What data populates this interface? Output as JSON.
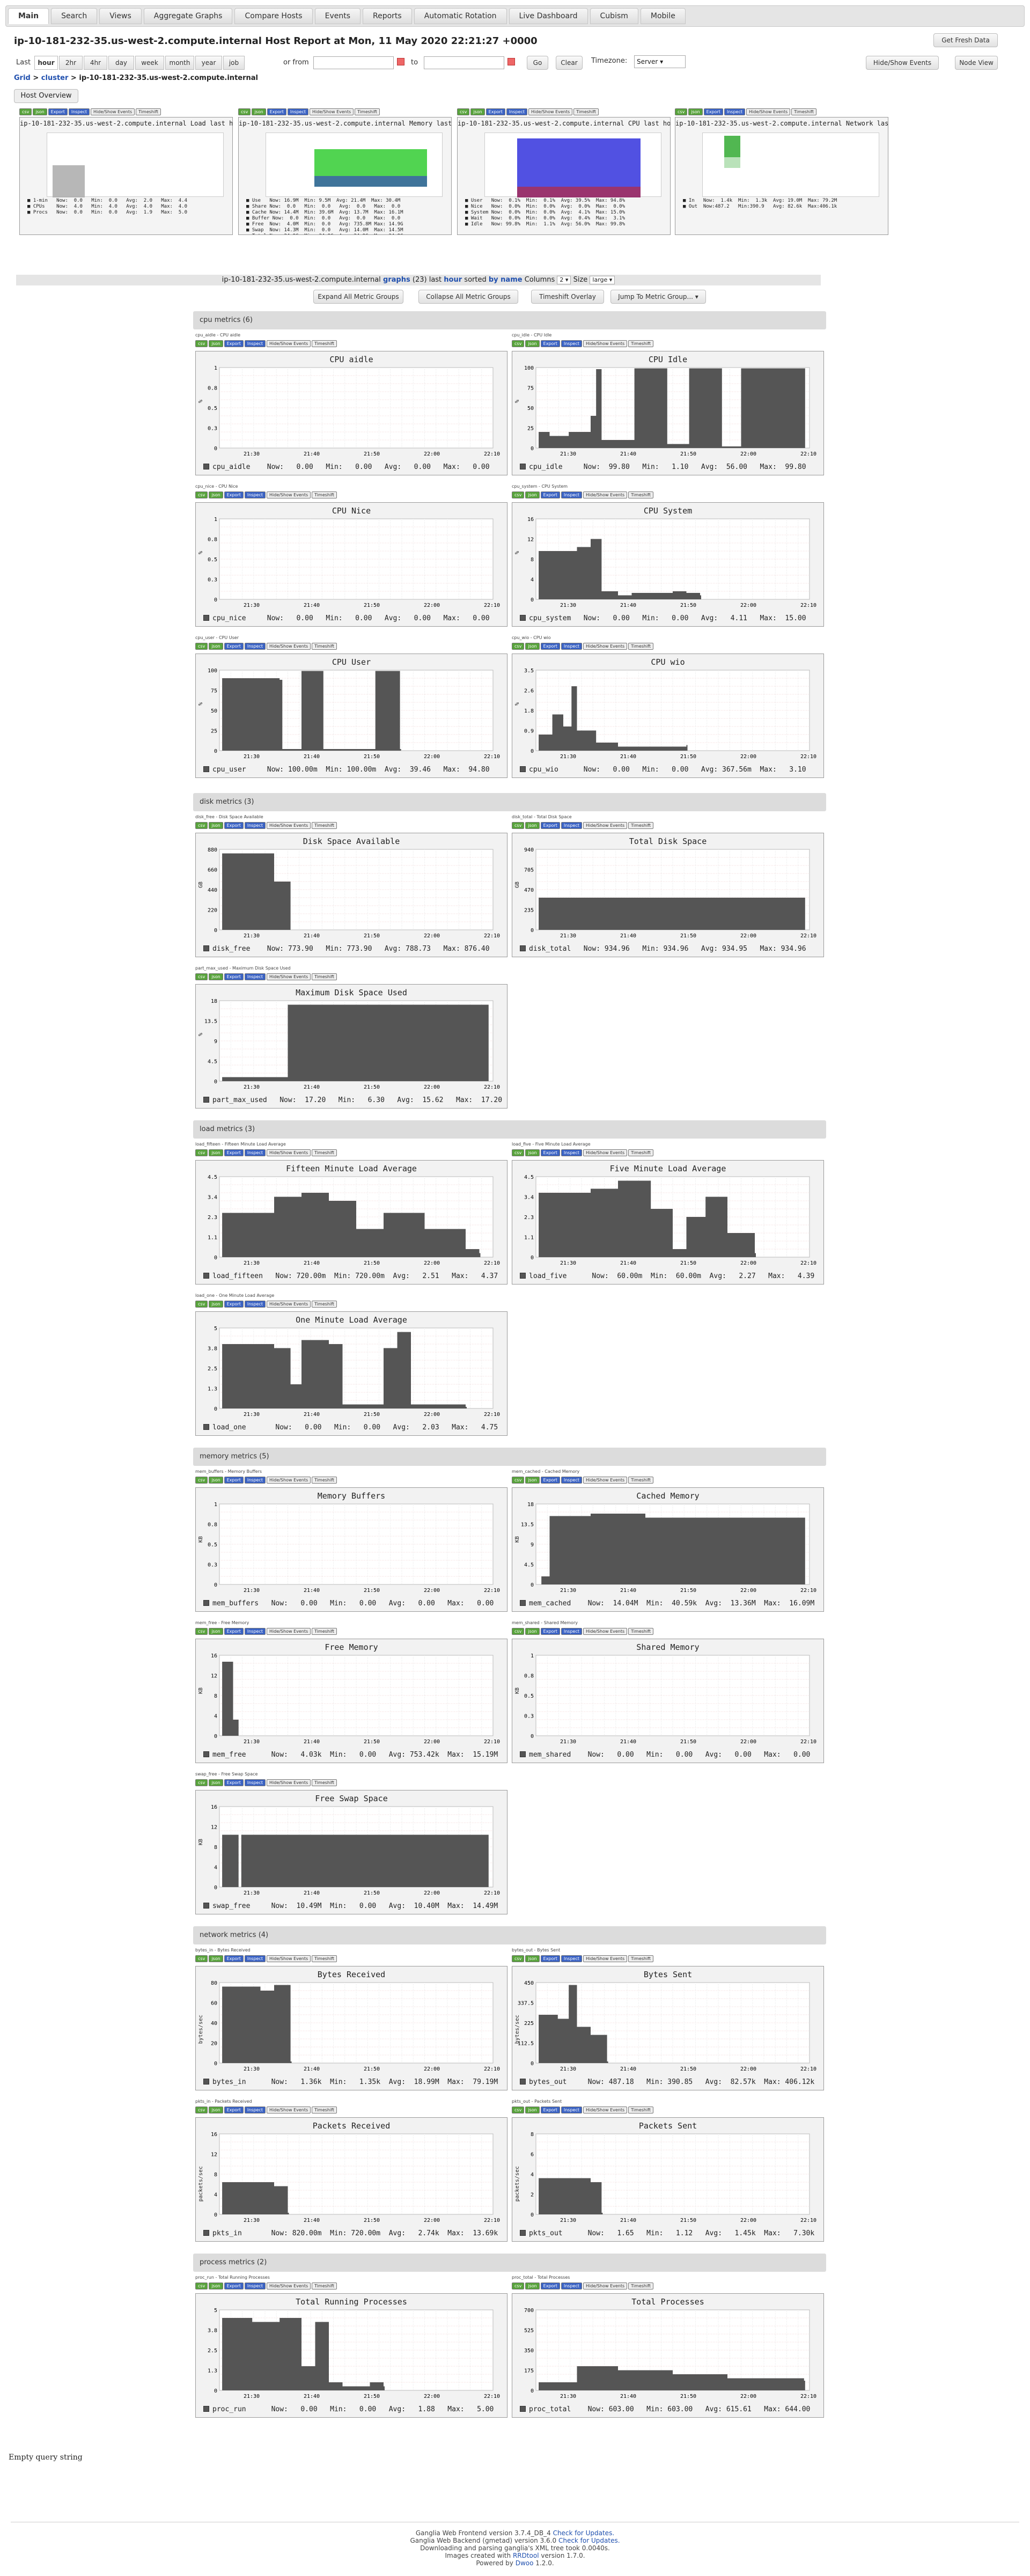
{
  "tabs": [
    "Main",
    "Search",
    "Views",
    "Aggregate Graphs",
    "Compare Hosts",
    "Events",
    "Reports",
    "Automatic Rotation",
    "Live Dashboard",
    "Cubism",
    "Mobile"
  ],
  "header": {
    "title": "ip-10-181-232-35.us-west-2.compute.internal Host Report at Mon, 11 May 2020 22:21:27 +0000",
    "fresh_button": "Get Fresh Data"
  },
  "toolbar": {
    "last_label": "Last",
    "ranges": [
      "hour",
      "2hr",
      "4hr",
      "day",
      "week",
      "month",
      "year",
      "job"
    ],
    "active_range": "hour",
    "or_from": "or from",
    "to": "to",
    "go": "Go",
    "clear": "Clear",
    "timezone_label": "Timezone:",
    "timezone_value": "Server",
    "hide_show": "Hide/Show Events",
    "node_view": "Node View"
  },
  "breadcrumb": {
    "grid": "Grid",
    "sep": " > ",
    "cluster": "cluster",
    "host": "ip-10-181-232-35.us-west-2.compute.internal"
  },
  "overview": {
    "label": "Host Overview",
    "graphs": [
      {
        "title": "ip-10-181-232-35.us-west-2.compute.internal Load last hour",
        "legend": "■ 1-min   Now:  0.0   Min:  0.0   Avg:  2.0   Max:  4.4\n■ CPUs    Now:  4.0   Min:  4.0   Avg:  4.0   Max:  4.0\n■ Procs   Now:  0.0   Min:  0.0   Avg:  1.9   Max:  5.0"
      },
      {
        "title": "ip-10-181-232-35.us-west-2.compute.internal Memory last hour",
        "legend": "■ Use   Now: 16.9M  Min: 9.5M  Avg: 21.4M  Max: 30.4M\n■ Share Now:  0.0   Min:  0.0   Avg:  0.0   Max:  0.0\n■ Cache Now: 14.4M  Min: 39.6M  Avg: 13.7M  Max: 16.1M\n■ Buffer Now:  0.0  Min:  0.0   Avg:  0.0   Max:  0.0\n■ Free  Now:  4.0M  Min:  0.0   Avg: 735.8M Max: 14.9G\n■ Swap  Now: 14.3M  Min:  0.0   Avg: 14.0M  Max: 14.5M\n■ Total Now: 24.9G  Min: 24.9G  Avg: 24.9G  Max: 24.9G"
      },
      {
        "title": "ip-10-181-232-35.us-west-2.compute.internal CPU last hour",
        "legend": "■ User   Now:  0.1%  Min:  0.1%  Avg: 39.5%  Max: 94.8%\n■ Nice   Now:  0.0%  Min:  0.0%  Avg:  0.0%  Max:  0.0%\n■ System Now:  0.0%  Min:  0.0%  Avg:  4.1%  Max: 15.0%\n■ Wait   Now:  0.0%  Min:  0.0%  Avg:  0.4%  Max:  3.1%\n■ Idle   Now: 99.8%  Min:  1.1%  Avg: 56.0%  Max: 99.8%"
      },
      {
        "title": "ip-10-181-232-35.us-west-2.compute.internal Network last hour",
        "legend": "■ In   Now:  1.4k  Min:  1.3k  Avg: 19.0M  Max: 79.2M\n■ Out  Now:487.2   Min:390.9   Avg: 82.6k  Max:406.1k"
      }
    ]
  },
  "summary": {
    "host": "ip-10-181-232-35.us-west-2.compute.internal",
    "graphs_word": "graphs",
    "count": "(23)",
    "mid": "last",
    "range": "hour",
    "sorted": "sorted",
    "by_name": "by name",
    "columns_label": "Columns",
    "columns_value": "2",
    "size_label": "Size",
    "size_value": "large"
  },
  "controls": {
    "expand": "Expand All Metric Groups",
    "collapse": "Collapse All Metric Groups",
    "timeshift": "Timeshift Overlay",
    "jump": "Jump To Metric Group..."
  },
  "mini_buttons": [
    "csv",
    "json",
    "Export",
    "Inspect",
    "Hide/Show Events",
    "Timeshift"
  ],
  "groups": [
    {
      "title": "cpu metrics (6)",
      "graphs": [
        {
          "tiny": "cpu_aidle - CPU aidle",
          "title": "CPU aidle",
          "ylabel": "%",
          "ymax": 1,
          "legend": "cpu_aidle    Now:   0.00   Min:   0.00   Avg:   0.00   Max:   0.00"
        },
        {
          "tiny": "cpu_idle - CPU Idle",
          "title": "CPU Idle",
          "ylabel": "%",
          "ymax": 100,
          "legend": "cpu_idle     Now:  99.80   Min:   1.10   Avg:  56.00   Max:  99.80"
        },
        {
          "tiny": "cpu_nice - CPU Nice",
          "title": "CPU Nice",
          "ylabel": "%",
          "ymax": 1,
          "legend": "cpu_nice     Now:   0.00   Min:   0.00   Avg:   0.00   Max:   0.00"
        },
        {
          "tiny": "cpu_system - CPU System",
          "title": "CPU System",
          "ylabel": "%",
          "ymax": 16,
          "legend": "cpu_system   Now:   0.00   Min:   0.00   Avg:   4.11   Max:  15.00"
        },
        {
          "tiny": "cpu_user - CPU User",
          "title": "CPU User",
          "ylabel": "%",
          "ymax": 100,
          "legend": "cpu_user     Now: 100.00m  Min: 100.00m  Avg:  39.46   Max:  94.80"
        },
        {
          "tiny": "cpu_wio - CPU wio",
          "title": "CPU wio",
          "ylabel": "%",
          "ymax": 3.5,
          "legend": "cpu_wio      Now:   0.00   Min:   0.00   Avg: 367.56m  Max:   3.10"
        }
      ]
    },
    {
      "title": "disk metrics (3)",
      "graphs": [
        {
          "tiny": "disk_free - Disk Space Available",
          "title": "Disk Space Available",
          "ylabel": "GB",
          "ymax": 880,
          "legend": "disk_free    Now: 773.90   Min: 773.90   Avg: 788.73   Max: 876.40"
        },
        {
          "tiny": "disk_total - Total Disk Space",
          "title": "Total Disk Space",
          "ylabel": "GB",
          "ymax": 940,
          "legend": "disk_total   Now: 934.96   Min: 934.96   Avg: 934.95   Max: 934.96"
        },
        {
          "tiny": "part_max_used - Maximum Disk Space Used",
          "title": "Maximum Disk Space Used",
          "ylabel": "%",
          "ymax": 18,
          "legend": "part_max_used   Now:  17.20   Min:   6.30   Avg:  15.62   Max:  17.20"
        }
      ]
    },
    {
      "title": "load metrics (3)",
      "graphs": [
        {
          "tiny": "load_fifteen - Fifteen Minute Load Average",
          "title": "Fifteen Minute Load Average",
          "ylabel": " ",
          "ymax": 4.5,
          "legend": "load_fifteen   Now: 720.00m  Min: 720.00m  Avg:   2.51   Max:   4.37"
        },
        {
          "tiny": "load_five - Five Minute Load Average",
          "title": "Five Minute Load Average",
          "ylabel": " ",
          "ymax": 4.5,
          "legend": "load_five      Now:  60.00m  Min:  60.00m  Avg:   2.27   Max:   4.39"
        },
        {
          "tiny": "load_one - One Minute Load Average",
          "title": "One Minute Load Average",
          "ylabel": " ",
          "ymax": 5,
          "legend": "load_one       Now:   0.00   Min:   0.00   Avg:   2.03   Max:   4.75"
        }
      ]
    },
    {
      "title": "memory metrics (5)",
      "graphs": [
        {
          "tiny": "mem_buffers - Memory Buffers",
          "title": "Memory Buffers",
          "ylabel": "KB",
          "ymax": 1,
          "legend": "mem_buffers   Now:   0.00   Min:   0.00   Avg:   0.00   Max:   0.00"
        },
        {
          "tiny": "mem_cached - Cached Memory",
          "title": "Cached Memory",
          "ylabel": "KB",
          "ymax": 18,
          "legend": "mem_cached    Now:  14.04M  Min:  40.59k  Avg:  13.36M  Max:  16.09M"
        },
        {
          "tiny": "mem_free - Free Memory",
          "title": "Free Memory",
          "ylabel": "KB",
          "ymax": 16,
          "legend": "mem_free      Now:   4.03k  Min:   0.00   Avg: 753.42k  Max:  15.19M"
        },
        {
          "tiny": "mem_shared - Shared Memory",
          "title": "Shared Memory",
          "ylabel": "KB",
          "ymax": 1,
          "legend": "mem_shared    Now:   0.00   Min:   0.00   Avg:   0.00   Max:   0.00"
        },
        {
          "tiny": "swap_free - Free Swap Space",
          "title": "Free Swap Space",
          "ylabel": "KB",
          "ymax": 16,
          "legend": "swap_free     Now:  10.49M  Min:   0.00   Avg:  10.40M  Max:  14.49M"
        }
      ]
    },
    {
      "title": "network metrics (4)",
      "graphs": [
        {
          "tiny": "bytes_in - Bytes Received",
          "title": "Bytes Received",
          "ylabel": "bytes/sec",
          "ymax": 80,
          "legend": "bytes_in      Now:   1.36k  Min:   1.35k  Avg:  18.99M  Max:  79.19M"
        },
        {
          "tiny": "bytes_out - Bytes Sent",
          "title": "Bytes Sent",
          "ylabel": "bytes/sec",
          "ymax": 450,
          "legend": "bytes_out     Now: 487.18   Min: 390.85   Avg:  82.57k  Max: 406.12k"
        },
        {
          "tiny": "pkts_in - Packets Received",
          "title": "Packets Received",
          "ylabel": "packets/sec",
          "ymax": 16,
          "legend": "pkts_in       Now: 820.00m  Min: 720.00m  Avg:   2.74k  Max:  13.69k"
        },
        {
          "tiny": "pkts_out - Packets Sent",
          "title": "Packets Sent",
          "ylabel": "packets/sec",
          "ymax": 8,
          "legend": "pkts_out      Now:   1.65   Min:   1.12   Avg:   1.45k  Max:   7.30k"
        }
      ]
    },
    {
      "title": "process metrics (2)",
      "graphs": [
        {
          "tiny": "proc_run - Total Running Processes",
          "title": "Total Running Processes",
          "ylabel": " ",
          "ymax": 5,
          "legend": "proc_run      Now:   0.00   Min:   0.00   Avg:   1.88   Max:   5.00"
        },
        {
          "tiny": "proc_total - Total Processes",
          "title": "Total Processes",
          "ylabel": " ",
          "ymax": 700,
          "legend": "proc_total    Now: 603.00   Min: 603.00   Avg: 615.61   Max: 644.00"
        }
      ]
    }
  ],
  "xticks": [
    "21:30",
    "21:40",
    "21:50",
    "22:00",
    "22:10"
  ],
  "empty_query": "Empty query string",
  "footer": {
    "l1": "Ganglia Web Frontend version 3.7.4_DB_4",
    "l1_link": "Check for Updates.",
    "l2": "Ganglia Web Backend (gmetad) version 3.6.0",
    "l2_link": "Check for Updates.",
    "l3": "Downloading and parsing ganglia's XML tree took 0.0040s.",
    "l4": "Images created with",
    "l4_link": "RRDtool",
    "l4_tail": "version 1.7.0.",
    "l5": "Powered by",
    "l5_link": "Dwoo",
    "l5_tail": "1.2.0."
  },
  "colors": {
    "fill": "#555555",
    "accent_blue": "#1f4fae"
  }
}
